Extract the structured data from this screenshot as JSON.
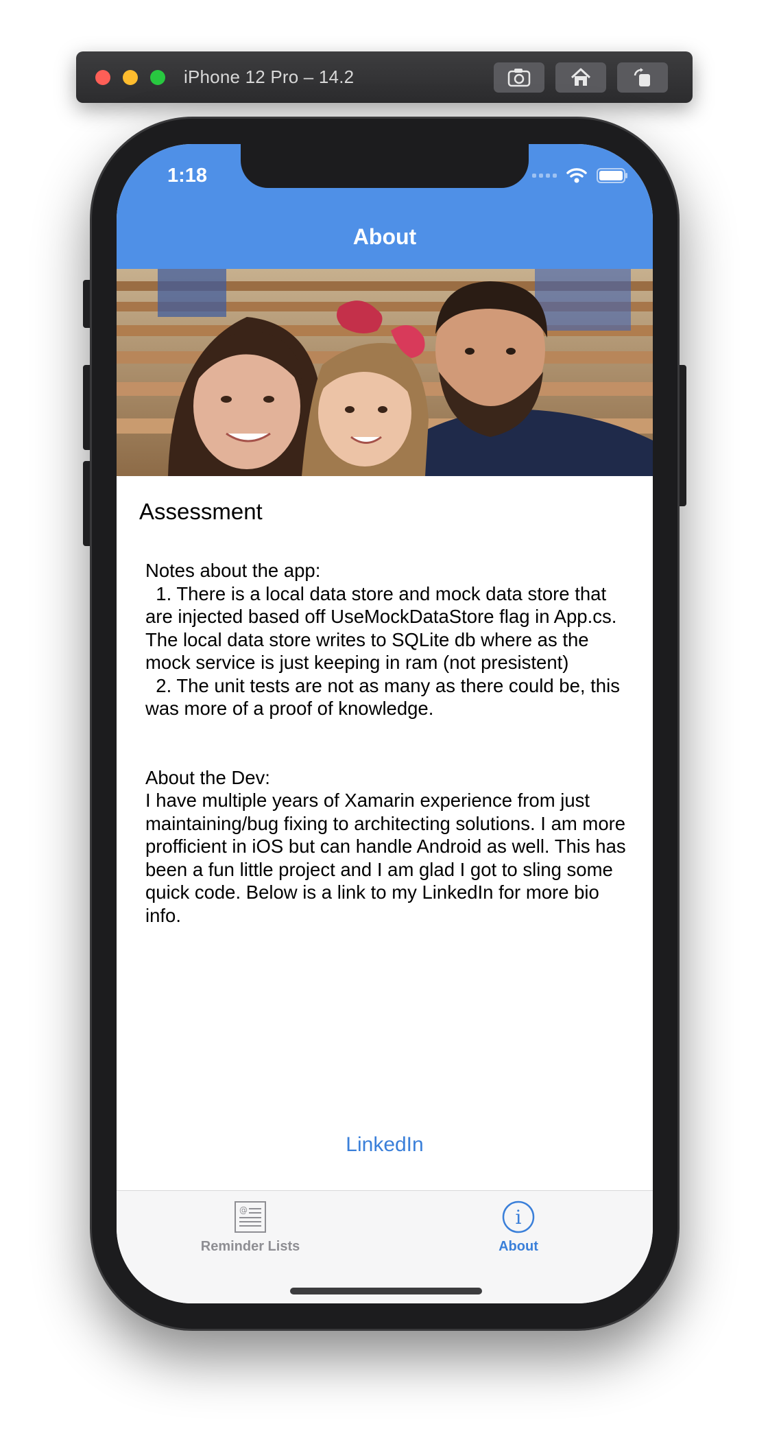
{
  "simulator": {
    "title": "iPhone 12 Pro – 14.2",
    "buttons": [
      "screenshot-icon",
      "home-icon",
      "rotate-icon"
    ]
  },
  "status_bar": {
    "time": "1:18"
  },
  "nav": {
    "title": "About",
    "color": "#4f90e7"
  },
  "content": {
    "section_title": "Assessment",
    "body": "Notes about the app:\n  1. There is a local data store and mock data store that are injected based off UseMockDataStore flag in App.cs. The local data store writes to SQLite db where as the mock service is just keeping in ram (not presistent)\n  2. The unit tests are not as many as there could be, this was more of a proof of knowledge.\n\n\nAbout the Dev:\nI have multiple years of Xamarin experience from just maintaining/bug fixing to architecting solutions. I am more profficient in iOS but can handle Android as well. This has been a fun little project and I am glad I got to sling some quick code. Below is a link to my LinkedIn for more bio info.",
    "link_label": "LinkedIn"
  },
  "tabbar": {
    "tabs": [
      {
        "label": "Reminder Lists",
        "icon": "reminder-list-icon",
        "selected": false
      },
      {
        "label": "About",
        "icon": "info-icon",
        "selected": true
      }
    ],
    "accent": "#3a7fd9",
    "inactive": "#8e8e93"
  }
}
